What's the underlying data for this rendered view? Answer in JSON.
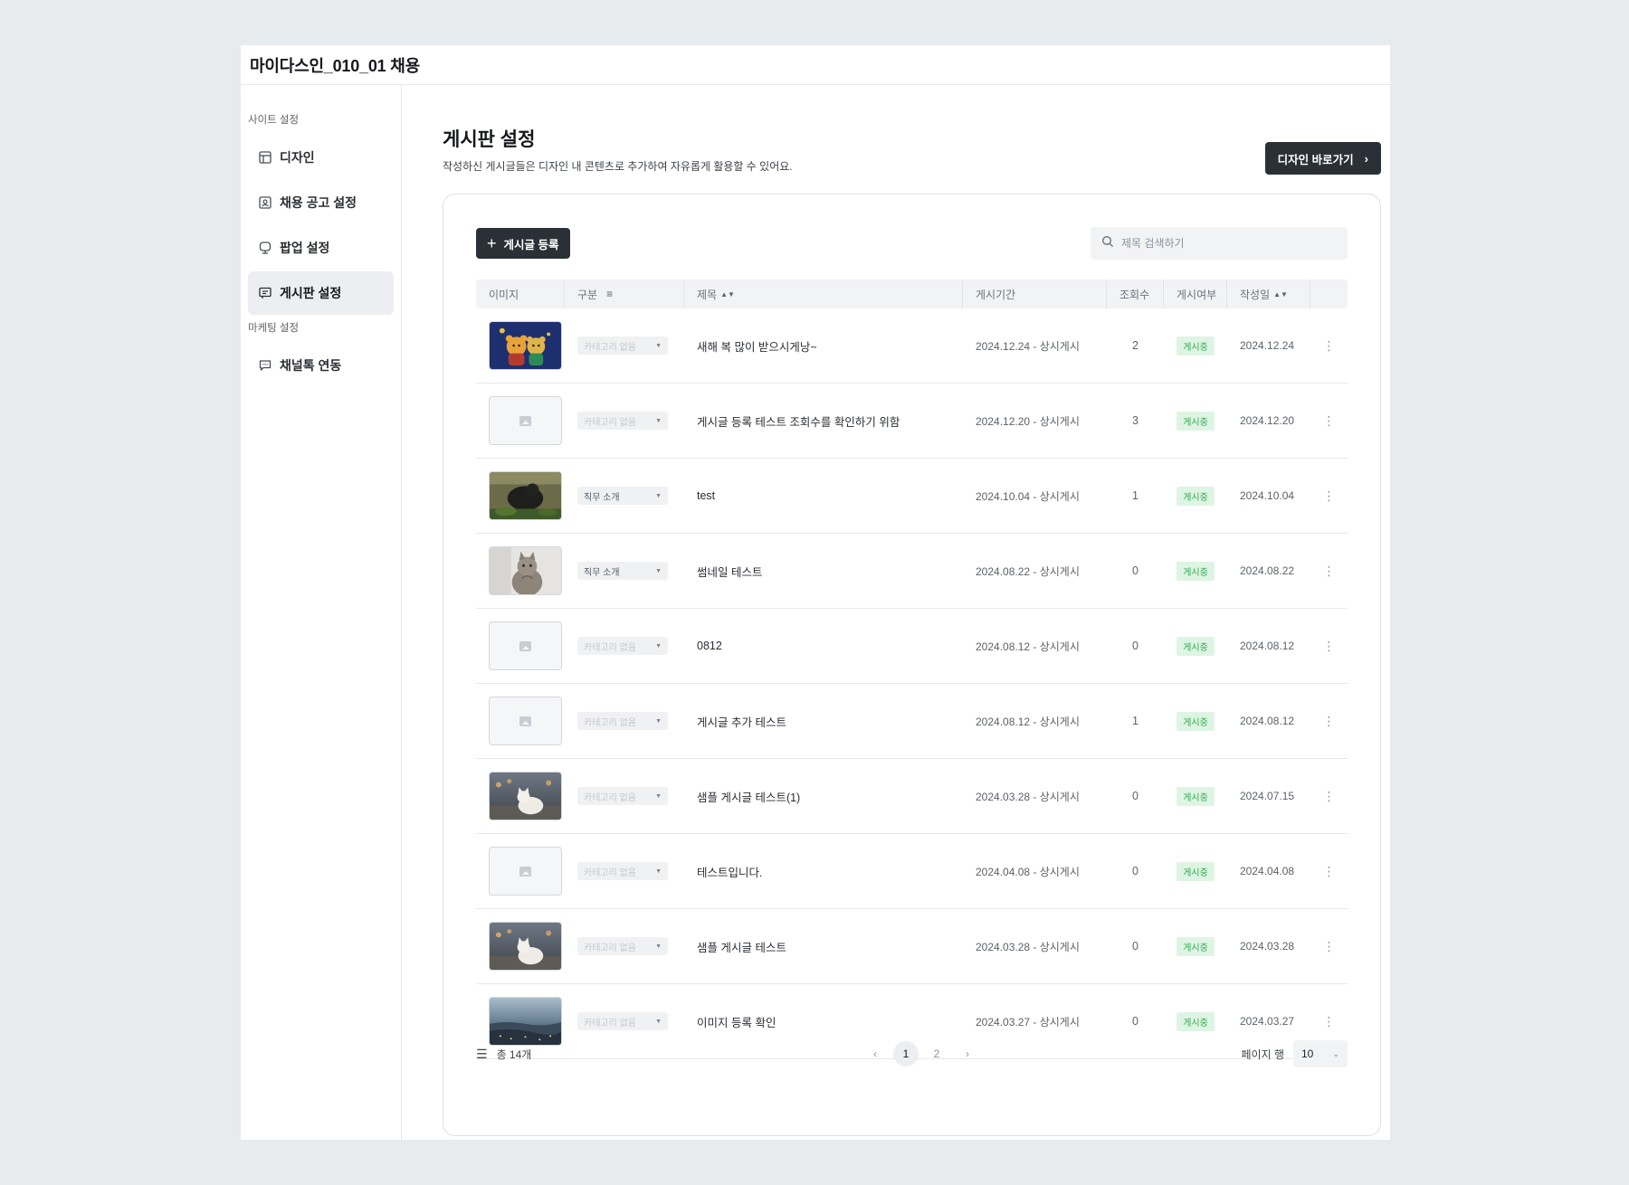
{
  "app": {
    "title": "마이다스인_010_01 채용"
  },
  "sidebar": {
    "section1": "사이트 설정",
    "items": [
      {
        "label": "디자인",
        "icon": "layout-icon",
        "active": false
      },
      {
        "label": "채용 공고 설정",
        "icon": "id-card-icon",
        "active": false
      },
      {
        "label": "팝업 설정",
        "icon": "popup-icon",
        "active": false
      },
      {
        "label": "게시판 설정",
        "icon": "board-icon",
        "active": true
      }
    ],
    "section2": "마케팅 설정",
    "items2": [
      {
        "label": "채널톡 연동",
        "icon": "chat-icon",
        "active": false
      }
    ]
  },
  "main": {
    "title": "게시판 설정",
    "subtitle": "작성하신 게시글들은 디자인 내 콘텐츠로 추가하여 자유롭게 활용할 수 있어요.",
    "design_button": "디자인 바로가기",
    "add_button": "게시글 등록",
    "search_placeholder": "제목 검색하기"
  },
  "table": {
    "headers": {
      "image": "이미지",
      "category": "구분",
      "title": "제목",
      "period": "게시기간",
      "views": "조회수",
      "status": "게시여부",
      "date": "작성일"
    },
    "rows": [
      {
        "image": "bears",
        "category": "카테고리 없음",
        "cat_set": false,
        "title": "새해 복 많이 받으시게낭~",
        "period": "2024.12.24 - 상시게시",
        "views": "2",
        "status": "게시중",
        "date": "2024.12.24"
      },
      {
        "image": "none",
        "category": "카테고리 없음",
        "cat_set": false,
        "title": "게시글 등록 테스트 조회수를 확인하기 위함",
        "period": "2024.12.20 - 상시게시",
        "views": "3",
        "status": "게시중",
        "date": "2024.12.20"
      },
      {
        "image": "gorilla",
        "category": "직무 소개",
        "cat_set": true,
        "title": "test",
        "period": "2024.10.04 - 상시게시",
        "views": "1",
        "status": "게시중",
        "date": "2024.10.04"
      },
      {
        "image": "cat",
        "category": "직무 소개",
        "cat_set": true,
        "title": "썸네일 테스트",
        "period": "2024.08.22 - 상시게시",
        "views": "0",
        "status": "게시중",
        "date": "2024.08.22"
      },
      {
        "image": "none",
        "category": "카테고리 없음",
        "cat_set": false,
        "title": "0812",
        "period": "2024.08.12 - 상시게시",
        "views": "0",
        "status": "게시중",
        "date": "2024.08.12"
      },
      {
        "image": "none",
        "category": "카테고리 없음",
        "cat_set": false,
        "title": "게시글 추가 테스트",
        "period": "2024.08.12 - 상시게시",
        "views": "1",
        "status": "게시중",
        "date": "2024.08.12"
      },
      {
        "image": "whitecat",
        "category": "카테고리 없음",
        "cat_set": false,
        "title": "샘플 게시글 테스트(1)",
        "period": "2024.03.28 - 상시게시",
        "views": "0",
        "status": "게시중",
        "date": "2024.07.15"
      },
      {
        "image": "none",
        "category": "카테고리 없음",
        "cat_set": false,
        "title": "테스트입니다.",
        "period": "2024.04.08 - 상시게시",
        "views": "0",
        "status": "게시중",
        "date": "2024.04.08"
      },
      {
        "image": "whitecat",
        "category": "카테고리 없음",
        "cat_set": false,
        "title": "샘플 게시글 테스트",
        "period": "2024.03.28 - 상시게시",
        "views": "0",
        "status": "게시중",
        "date": "2024.03.28"
      },
      {
        "image": "city",
        "category": "카테고리 없음",
        "cat_set": false,
        "title": "이미지 등록 확인",
        "period": "2024.03.27 - 상시게시",
        "views": "0",
        "status": "게시중",
        "date": "2024.03.27"
      }
    ]
  },
  "footer": {
    "total": "총 14개",
    "pages": [
      "1",
      "2"
    ],
    "current_page": "1",
    "rows_label": "페이지 행",
    "rows_value": "10"
  },
  "colors": {
    "primary_dark": "#2b3036",
    "status_green": "#2fa84f",
    "status_bg": "#dff5e3"
  }
}
